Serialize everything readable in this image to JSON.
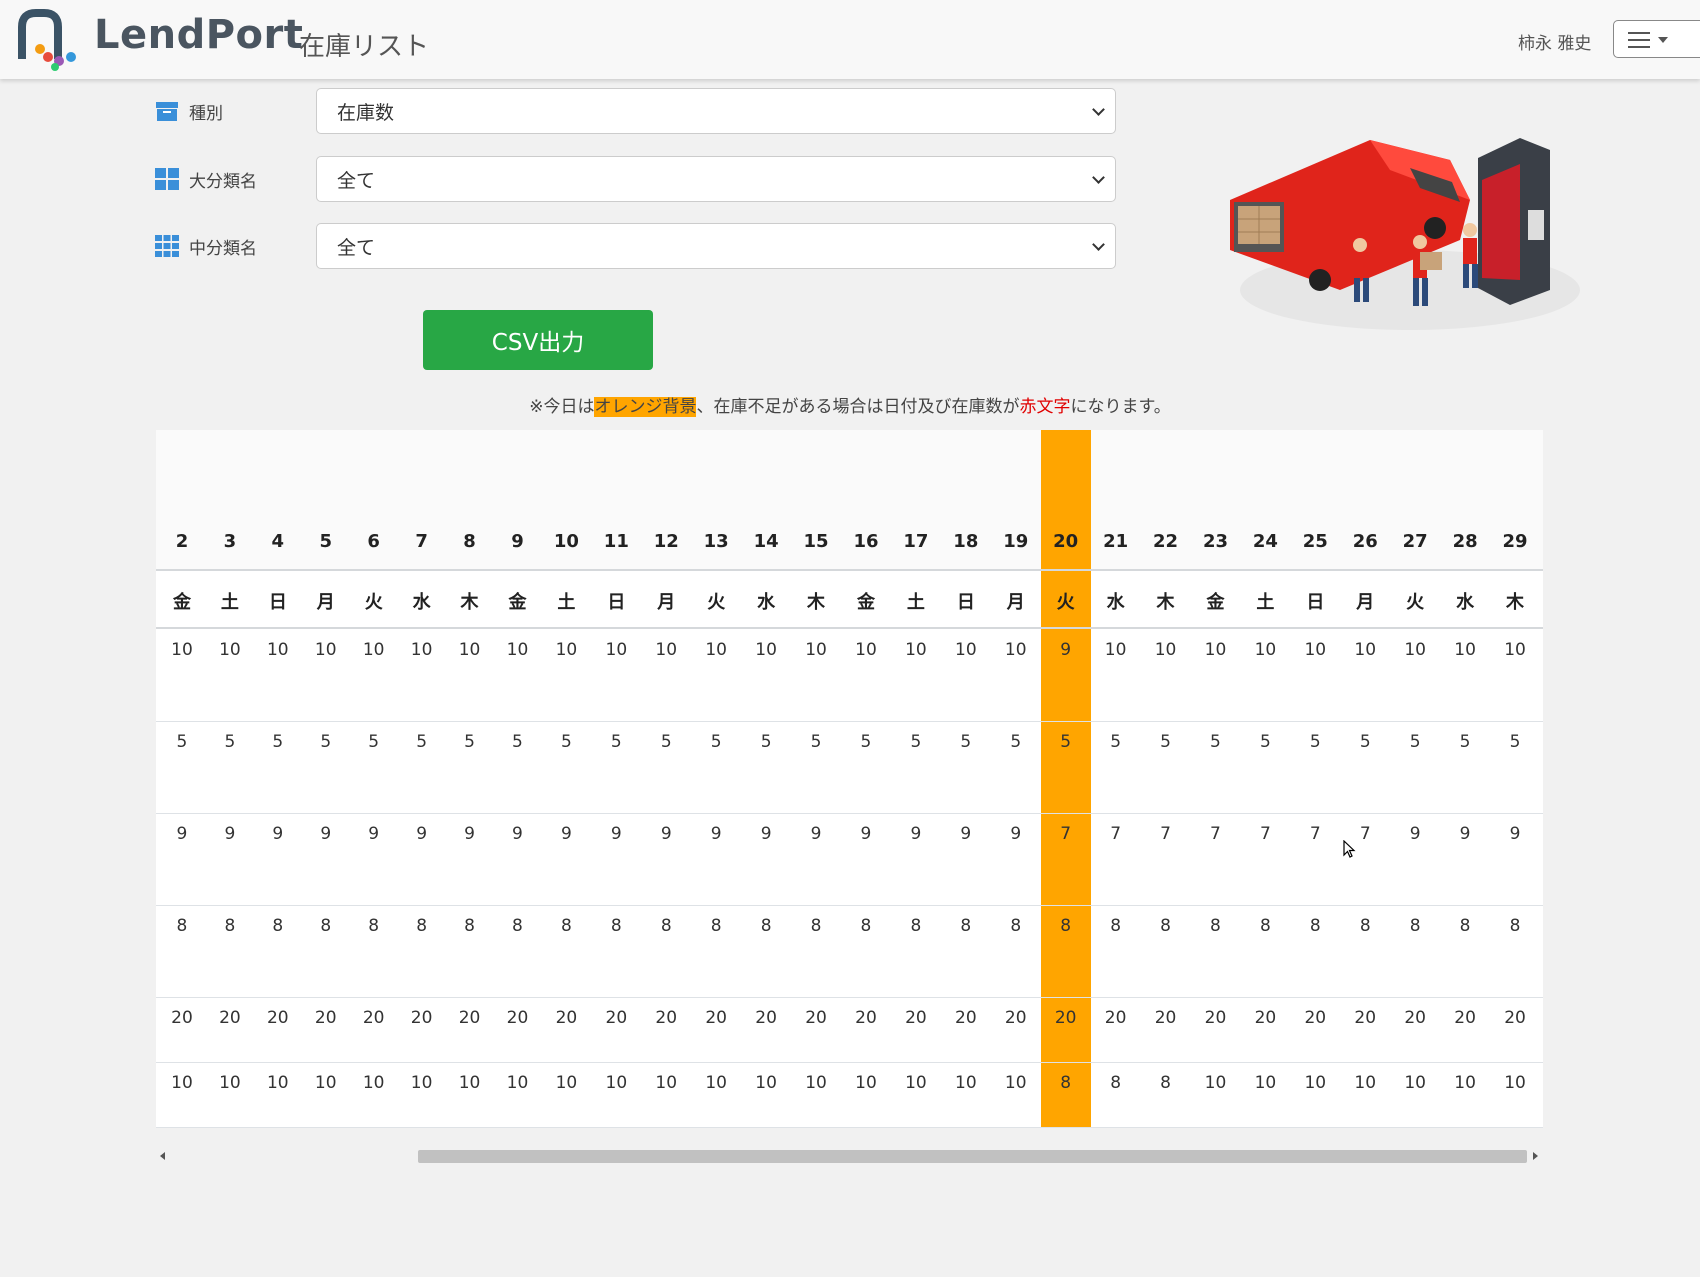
{
  "header": {
    "brand": "LendPort",
    "page_title": "在庫リスト",
    "user_name": "柿永 雅史"
  },
  "filters": [
    {
      "label": "種別",
      "icon": "archive-box-icon",
      "value": "在庫数"
    },
    {
      "label": "大分類名",
      "icon": "grid-large-icon",
      "value": "全て"
    },
    {
      "label": "中分類名",
      "icon": "grid-small-icon",
      "value": "全て"
    }
  ],
  "csv_button": "CSV出力",
  "notice": {
    "prefix": "※今日は",
    "highlight": "オレンジ背景",
    "middle": "、在庫不足がある場合は日付及び在庫数が",
    "red": "赤文字",
    "suffix": "になります。"
  },
  "colors": {
    "today_bg": "#ffa500",
    "csv_button": "#28a745",
    "alert_text": "#e00000"
  },
  "table": {
    "today_index": 18,
    "days": [
      "2",
      "3",
      "4",
      "5",
      "6",
      "7",
      "8",
      "9",
      "10",
      "11",
      "12",
      "13",
      "14",
      "15",
      "16",
      "17",
      "18",
      "19",
      "20",
      "21",
      "22",
      "23",
      "24",
      "25",
      "26",
      "27",
      "28",
      "29"
    ],
    "dows": [
      "金",
      "土",
      "日",
      "月",
      "火",
      "水",
      "木",
      "金",
      "土",
      "日",
      "月",
      "火",
      "水",
      "木",
      "金",
      "土",
      "日",
      "月",
      "火",
      "水",
      "木",
      "金",
      "土",
      "日",
      "月",
      "火",
      "水",
      "木"
    ],
    "rows": [
      [
        "10",
        "10",
        "10",
        "10",
        "10",
        "10",
        "10",
        "10",
        "10",
        "10",
        "10",
        "10",
        "10",
        "10",
        "10",
        "10",
        "10",
        "10",
        "9",
        "10",
        "10",
        "10",
        "10",
        "10",
        "10",
        "10",
        "10",
        "10"
      ],
      [
        "5",
        "5",
        "5",
        "5",
        "5",
        "5",
        "5",
        "5",
        "5",
        "5",
        "5",
        "5",
        "5",
        "5",
        "5",
        "5",
        "5",
        "5",
        "5",
        "5",
        "5",
        "5",
        "5",
        "5",
        "5",
        "5",
        "5",
        "5"
      ],
      [
        "9",
        "9",
        "9",
        "9",
        "9",
        "9",
        "9",
        "9",
        "9",
        "9",
        "9",
        "9",
        "9",
        "9",
        "9",
        "9",
        "9",
        "9",
        "7",
        "7",
        "7",
        "7",
        "7",
        "7",
        "7",
        "9",
        "9",
        "9"
      ],
      [
        "8",
        "8",
        "8",
        "8",
        "8",
        "8",
        "8",
        "8",
        "8",
        "8",
        "8",
        "8",
        "8",
        "8",
        "8",
        "8",
        "8",
        "8",
        "8",
        "8",
        "8",
        "8",
        "8",
        "8",
        "8",
        "8",
        "8",
        "8"
      ],
      [
        "20",
        "20",
        "20",
        "20",
        "20",
        "20",
        "20",
        "20",
        "20",
        "20",
        "20",
        "20",
        "20",
        "20",
        "20",
        "20",
        "20",
        "20",
        "20",
        "20",
        "20",
        "20",
        "20",
        "20",
        "20",
        "20",
        "20",
        "20"
      ],
      [
        "10",
        "10",
        "10",
        "10",
        "10",
        "10",
        "10",
        "10",
        "10",
        "10",
        "10",
        "10",
        "10",
        "10",
        "10",
        "10",
        "10",
        "10",
        "8",
        "8",
        "8",
        "10",
        "10",
        "10",
        "10",
        "10",
        "10",
        "10"
      ]
    ]
  }
}
